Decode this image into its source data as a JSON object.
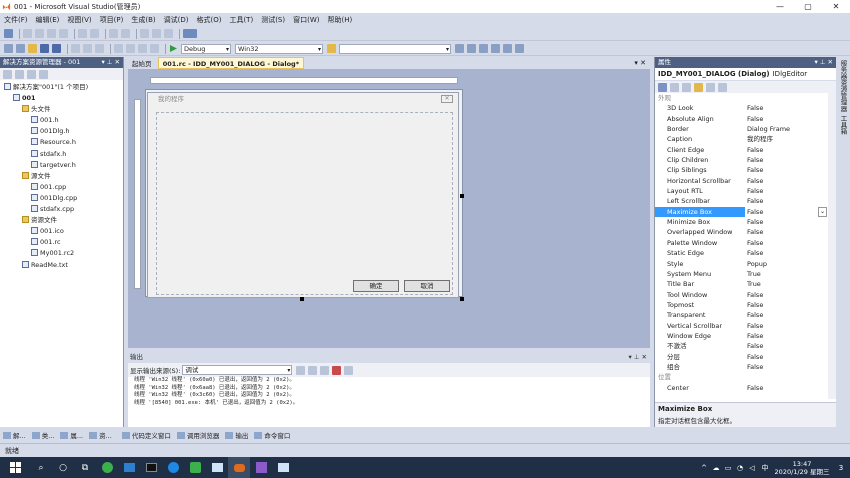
{
  "window": {
    "title": "001 - Microsoft Visual Studio(管理员)",
    "controls": [
      "—",
      "▢",
      "✕"
    ]
  },
  "menu": [
    "文件(F)",
    "编辑(E)",
    "视图(V)",
    "项目(P)",
    "生成(B)",
    "调试(D)",
    "格式(O)",
    "工具(T)",
    "测试(S)",
    "窗口(W)",
    "帮助(H)"
  ],
  "toolbar": {
    "config": "Debug",
    "platform": "Win32"
  },
  "solution": {
    "title": "解决方案资源管理器 - 001",
    "items": [
      {
        "label": "解决方案\"001\"(1 个项目)",
        "level": 0,
        "type": "sln"
      },
      {
        "label": "001",
        "level": 1,
        "type": "proj"
      },
      {
        "label": "头文件",
        "level": 2,
        "type": "folder"
      },
      {
        "label": "001.h",
        "level": 3,
        "type": "file"
      },
      {
        "label": "001Dlg.h",
        "level": 3,
        "type": "file"
      },
      {
        "label": "Resource.h",
        "level": 3,
        "type": "file"
      },
      {
        "label": "stdafx.h",
        "level": 3,
        "type": "file"
      },
      {
        "label": "targetver.h",
        "level": 3,
        "type": "file"
      },
      {
        "label": "源文件",
        "level": 2,
        "type": "folder"
      },
      {
        "label": "001.cpp",
        "level": 3,
        "type": "file"
      },
      {
        "label": "001Dlg.cpp",
        "level": 3,
        "type": "file"
      },
      {
        "label": "stdafx.cpp",
        "level": 3,
        "type": "file"
      },
      {
        "label": "资源文件",
        "level": 2,
        "type": "folder"
      },
      {
        "label": "001.ico",
        "level": 3,
        "type": "file"
      },
      {
        "label": "001.rc",
        "level": 3,
        "type": "file"
      },
      {
        "label": "My001.rc2",
        "level": 3,
        "type": "file"
      },
      {
        "label": "ReadMe.txt",
        "level": 2,
        "type": "file"
      }
    ]
  },
  "editor": {
    "tabs": [
      {
        "label": "起始页"
      },
      {
        "label": "001.rc - IDD_MY001_DIALOG - Dialog*"
      }
    ],
    "dialog": {
      "title": "我的程序",
      "ok": "确定",
      "cancel": "取消"
    }
  },
  "output": {
    "title": "输出",
    "source_label": "显示输出来源(S):",
    "source_value": "调试",
    "lines": [
      "线程 'Win32 线程' (0x60a0) 已退出，返回值为 2 (0x2)。",
      "线程 'Win32 线程' (0x6aa8) 已退出，返回值为 2 (0x2)。",
      "线程 'Win32 线程' (0x3c60) 已退出，返回值为 2 (0x2)。",
      "线程 '[8540] 001.exe: 本机' 已退出，返回值为 2 (0x2)。"
    ]
  },
  "properties": {
    "title": "属性",
    "object": "IDD_MY001_DIALOG (Dialog)",
    "object_type": "IDlgEditor",
    "category_appearance": "外观",
    "category_position": "位置",
    "rows": [
      {
        "name": "3D Look",
        "value": "False"
      },
      {
        "name": "Absolute Align",
        "value": "False"
      },
      {
        "name": "Border",
        "value": "Dialog Frame"
      },
      {
        "name": "Caption",
        "value": "我的程序"
      },
      {
        "name": "Client Edge",
        "value": "False"
      },
      {
        "name": "Clip Children",
        "value": "False"
      },
      {
        "name": "Clip Siblings",
        "value": "False"
      },
      {
        "name": "Horizontal Scrollbar",
        "value": "False"
      },
      {
        "name": "Layout RTL",
        "value": "False"
      },
      {
        "name": "Left Scrollbar",
        "value": "False"
      },
      {
        "name": "Maximize Box",
        "value": "False",
        "selected": true
      },
      {
        "name": "Minimize Box",
        "value": "False"
      },
      {
        "name": "Overlapped Window",
        "value": "False"
      },
      {
        "name": "Palette Window",
        "value": "False"
      },
      {
        "name": "Static Edge",
        "value": "False"
      },
      {
        "name": "Style",
        "value": "Popup"
      },
      {
        "name": "System Menu",
        "value": "True"
      },
      {
        "name": "Title Bar",
        "value": "True"
      },
      {
        "name": "Tool Window",
        "value": "False"
      },
      {
        "name": "Topmost",
        "value": "False"
      },
      {
        "name": "Transparent",
        "value": "False"
      },
      {
        "name": "Vertical Scrollbar",
        "value": "False"
      },
      {
        "name": "Window Edge",
        "value": "False"
      },
      {
        "name": "不激活",
        "value": "False"
      },
      {
        "name": "分层",
        "value": "False"
      },
      {
        "name": "组合",
        "value": "False"
      }
    ],
    "after_position": [
      {
        "name": "Center",
        "value": "False"
      }
    ],
    "desc_title": "Maximize Box",
    "desc_text": "指定对话框包含最大化框。"
  },
  "right_sidebar": [
    "服务器资源管理器",
    "工具箱"
  ],
  "bottom_tabs": [
    "解...",
    "类...",
    "属...",
    "资...",
    "代码定义窗口",
    "调用浏览器",
    "输出",
    "命令窗口"
  ],
  "status": "就绪",
  "clock": {
    "time": "13:47",
    "date": "2020/1/29 星期三"
  },
  "tray": {
    "ime": "中",
    "notify": "3"
  }
}
